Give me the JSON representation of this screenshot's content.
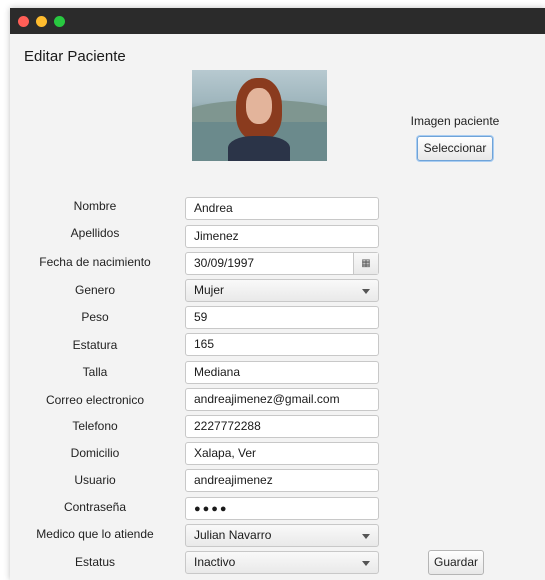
{
  "window": {
    "title": "Editar Paciente"
  },
  "image": {
    "label": "Imagen paciente",
    "select_label": "Seleccionar",
    "alt": "patient-photo"
  },
  "form": {
    "nombre": {
      "label": "Nombre",
      "value": "Andrea"
    },
    "apellidos": {
      "label": "Apellidos",
      "value": "Jimenez"
    },
    "fecha": {
      "label": "Fecha de nacimiento",
      "value": "30/09/1997",
      "icon": "calendar-icon"
    },
    "genero": {
      "label": "Genero",
      "value": "Mujer"
    },
    "peso": {
      "label": "Peso",
      "value": "59"
    },
    "estatura": {
      "label": "Estatura",
      "value": "165"
    },
    "talla": {
      "label": "Talla",
      "value": "Mediana"
    },
    "correo": {
      "label": "Correo electronico",
      "value": "andreajimenez@gmail.com"
    },
    "telefono": {
      "label": "Telefono",
      "value": "2227772288"
    },
    "domicilio": {
      "label": "Domicilio",
      "value": "Xalapa, Ver"
    },
    "usuario": {
      "label": "Usuario",
      "value": "andreajimenez"
    },
    "contrasena": {
      "label": "Contraseña",
      "value": "●●●●"
    },
    "medico": {
      "label": "Medico que lo atiende",
      "value": "Julian Navarro"
    },
    "estatus": {
      "label": "Estatus",
      "value": "Inactivo"
    }
  },
  "actions": {
    "save_label": "Guardar"
  }
}
